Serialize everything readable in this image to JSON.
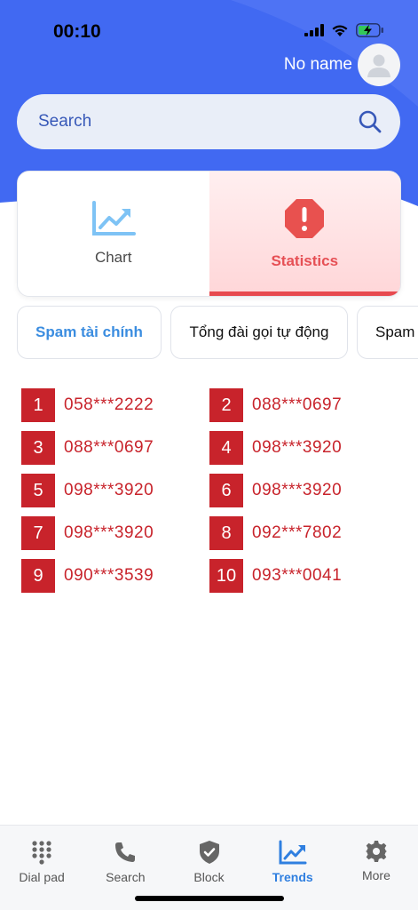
{
  "status_bar": {
    "time": "00:10"
  },
  "profile": {
    "name": "No name"
  },
  "search": {
    "placeholder": "Search"
  },
  "tabs": [
    {
      "label": "Chart",
      "icon": "chart-icon"
    },
    {
      "label": "Statistics",
      "icon": "alert-octagon-icon"
    }
  ],
  "chips": [
    {
      "label": "Spam tài chính"
    },
    {
      "label": "Tổng đài gọi tự động"
    },
    {
      "label": "Spam"
    }
  ],
  "rankings": [
    {
      "rank": "1",
      "phone": "058***2222"
    },
    {
      "rank": "2",
      "phone": "088***0697"
    },
    {
      "rank": "3",
      "phone": "088***0697"
    },
    {
      "rank": "4",
      "phone": "098***3920"
    },
    {
      "rank": "5",
      "phone": "098***3920"
    },
    {
      "rank": "6",
      "phone": "098***3920"
    },
    {
      "rank": "7",
      "phone": "098***3920"
    },
    {
      "rank": "8",
      "phone": "092***7802"
    },
    {
      "rank": "9",
      "phone": "090***3539"
    },
    {
      "rank": "10",
      "phone": "093***0041"
    }
  ],
  "bottom_nav": [
    {
      "label": "Dial pad",
      "icon": "dialpad-icon"
    },
    {
      "label": "Search",
      "icon": "phone-icon"
    },
    {
      "label": "Block",
      "icon": "shield-check-icon"
    },
    {
      "label": "Trends",
      "icon": "trending-up-icon"
    },
    {
      "label": "More",
      "icon": "gear-icon"
    }
  ],
  "colors": {
    "header": "#3d66f0",
    "rank_red": "#c8232b",
    "active_blue": "#2f7fe0",
    "stats_red": "#e65055"
  }
}
